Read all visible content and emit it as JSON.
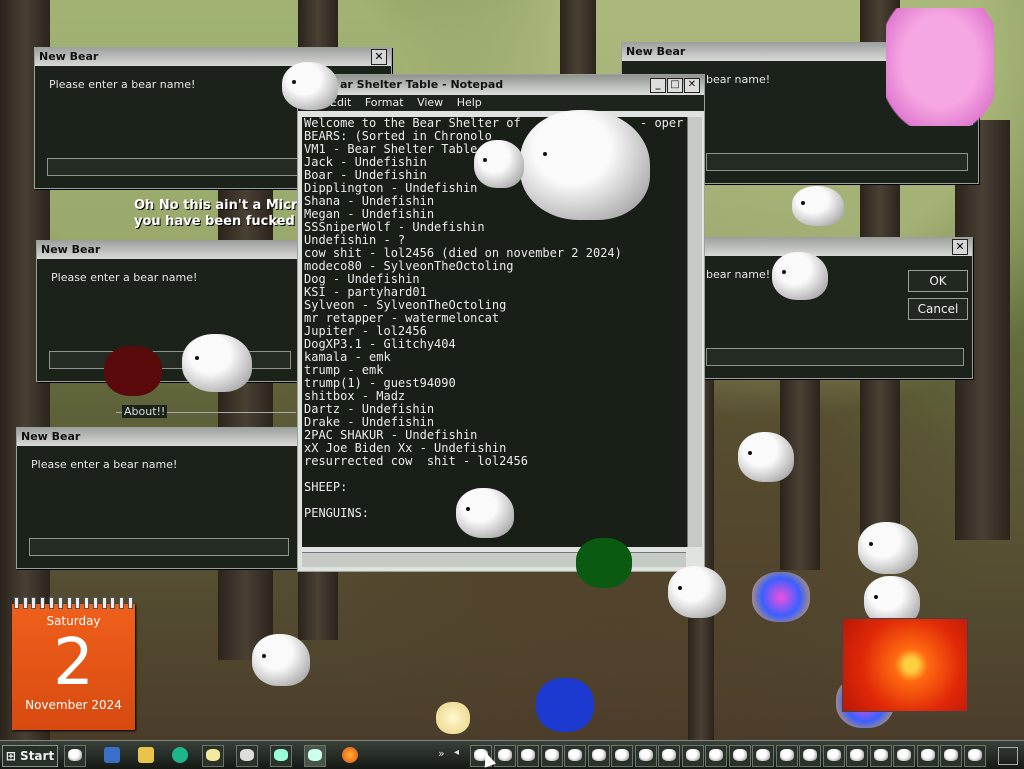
{
  "dialog": {
    "title": "New Bear",
    "prompt": "Please enter a bear name!",
    "prompt_partial": "bear name!",
    "ok": "OK",
    "cancel": "Cancel",
    "about_label": "About!!"
  },
  "message": {
    "line1": "Oh No this ain't a Micro",
    "line2": "you have been fucked !!"
  },
  "notepad": {
    "title": "ar Shelter Table - Notepad",
    "menu": [
      "Edit",
      "Format",
      "View",
      "Help"
    ],
    "lines": [
      "Welcome to the Bear Shelter of",
      "BEARS: (Sorted in Chronolo",
      "VM1 - Bear Shelter Table",
      "Jack - Undefishin",
      "Boar - Undefishin",
      "Dipplington - Undefishin",
      "Shana - Undefishin",
      "Megan - Undefishin",
      "SSSniperWolf - Undefishin",
      "Undefishin - ?",
      "cow shit - lol2456 (died on november 2 2024)",
      "modeco80 - SylveonTheOctoling",
      "Dog - Undefishin",
      "KSI - partyhard01",
      "Sylveon - SylveonTheOctoling",
      "mr retapper - watermeloncat",
      "Jupiter - lol2456",
      "DogXP3.1 - Glitchy404",
      "kamala - emk",
      "trump - emk",
      "trump(1) - guest94090",
      "shitbox - Madz",
      "Dartz - Undefishin",
      "Drake - Undefishin",
      "2PAC SHAKUR - Undefishin",
      "xX Joe Biden Xx - Undefishin",
      "resurrected cow  shit - lol2456",
      "",
      "SHEEP:",
      "",
      "PENGUINS:"
    ],
    "line1_suffix": "- oper"
  },
  "calendar": {
    "weekday": "Saturday",
    "day": "2",
    "month_year": "November 2024"
  },
  "taskbar": {
    "start": "Start",
    "bear_buttons": 22,
    "colors": {
      "bar": "#1a201a",
      "calendar": "#e2561a"
    }
  }
}
